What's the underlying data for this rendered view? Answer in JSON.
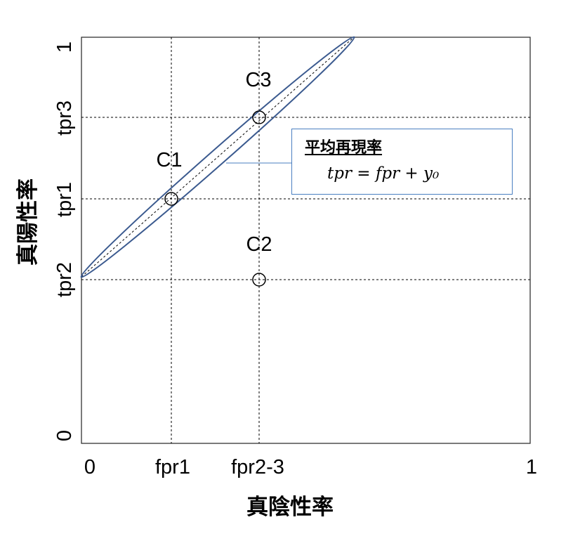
{
  "axes": {
    "x_title": "真陰性率",
    "y_title": "真陽性率",
    "x_ticks": {
      "zero": "0",
      "fpr1": "fpr1",
      "fpr23": "fpr2-3",
      "one": "1"
    },
    "y_ticks": {
      "zero": "0",
      "tpr2": "tpr2",
      "tpr1": "tpr1",
      "tpr3": "tpr3",
      "one": "1"
    }
  },
  "points": {
    "c1": "C1",
    "c2": "C2",
    "c3": "C3"
  },
  "callout": {
    "title": "平均再現率",
    "formula": "tpr = fpr + y₀"
  },
  "colors": {
    "ellipse": "#3b5a8f",
    "callout_border": "#4a7fc1",
    "grid": "#000000"
  }
}
